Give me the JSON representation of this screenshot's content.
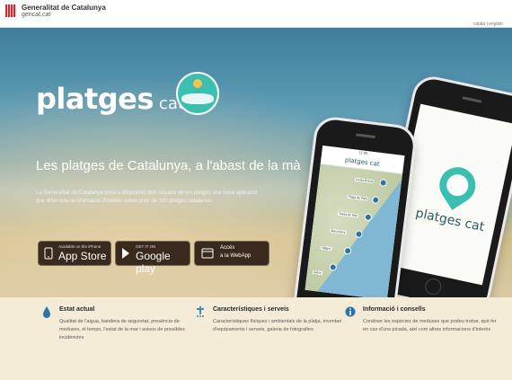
{
  "govbar": {
    "name": "Generalitat de Catalunya",
    "site": "gencat.cat",
    "language": "català | english"
  },
  "hero": {
    "brand_main": "platges",
    "brand_sub": "cat",
    "tagline": "Les platges de Catalunya, a l'abast de la mà",
    "description": "La Generalitat de Catalunya posa a disposició dels usuaris de les platges una nova aplicació que difon tota la informació d'interès sobre prop de 300 platges catalanes."
  },
  "stores": {
    "appstore_small": "Available on the iPhone",
    "appstore_big": "App Store",
    "googleplay_small": "GET IT ON",
    "googleplay_big": "Google play",
    "webapp_line1": "Accés",
    "webapp_line2": "a la WebApp"
  },
  "phone_back": {
    "app_name": "platges cat"
  },
  "phone_front": {
    "time": "11:05",
    "title": "platges cat",
    "map_labels": [
      "Costa Brava",
      "Platja de Pals",
      "Tossa de Mar",
      "Barcelona",
      "Sitges",
      "Salou"
    ]
  },
  "features": [
    {
      "title": "Estat actual",
      "description": "Qualitat de l'aigua, bandera de seguretat, presència de meduses, el temps, l'estat de la mar i avisos de possibles incidències"
    },
    {
      "title": "Característiques i serveis",
      "description": "Característiques físiques i ambientals de la platja, inventari d'equipaments i serveis, galeria de fotografies"
    },
    {
      "title": "Informació i consells",
      "description": "Conèixer les espècies de meduses que podeu trobar, què fer en cas d'una picada, així com altres informacions d'interès"
    }
  ],
  "colors": {
    "teal_accent": "#3bbfb0",
    "feature_bg": "#f5ecd7",
    "store_button_bg": "#3a2a1e"
  }
}
